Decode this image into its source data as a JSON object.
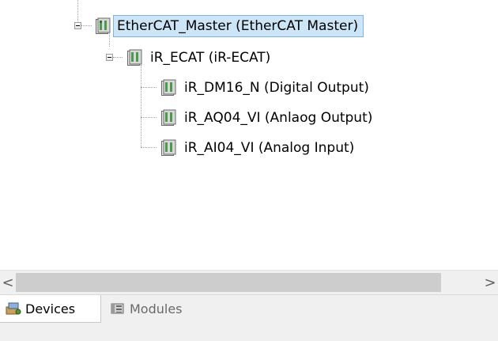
{
  "tree": {
    "nodes": [
      {
        "label": "EtherCAT_Master (EtherCAT Master)",
        "icon": "device-icon",
        "expanded": true,
        "selected": true
      },
      {
        "label": "iR_ECAT (iR-ECAT)",
        "icon": "device-icon",
        "expanded": true,
        "selected": false
      },
      {
        "label": "iR_DM16_N (Digital Output)",
        "icon": "device-icon",
        "selected": false
      },
      {
        "label": "iR_AQ04_VI (Anlaog Output)",
        "icon": "device-icon",
        "selected": false
      },
      {
        "label": "iR_AI04_VI (Analog Input)",
        "icon": "device-icon",
        "selected": false
      }
    ]
  },
  "scrollbar": {
    "left_arrow": "<",
    "right_arrow": ">"
  },
  "tabs": [
    {
      "label": "Devices",
      "icon": "devices-icon",
      "active": true
    },
    {
      "label": "Modules",
      "icon": "modules-icon",
      "active": false
    }
  ],
  "colors": {
    "selection_bg": "#cde6f7",
    "selection_border": "#7eb4ea",
    "panel_bg": "#f0f0f0"
  }
}
